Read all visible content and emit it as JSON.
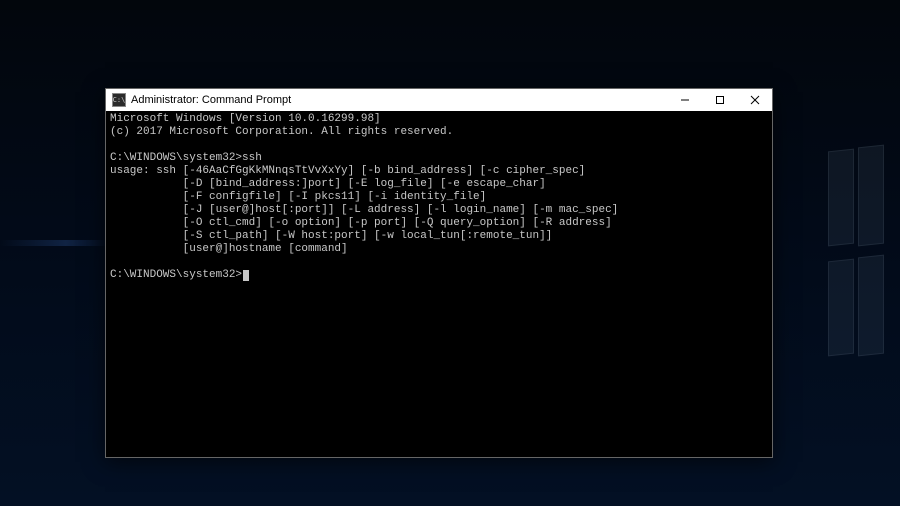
{
  "window": {
    "title": "Administrator: Command Prompt",
    "icon_label": "C:\\"
  },
  "terminal": {
    "banner_line1": "Microsoft Windows [Version 10.0.16299.98]",
    "banner_line2": "(c) 2017 Microsoft Corporation. All rights reserved.",
    "prompt1_path": "C:\\WINDOWS\\system32>",
    "prompt1_cmd": "ssh",
    "usage_lines": [
      "usage: ssh [-46AaCfGgKkMNnqsTtVvXxYy] [-b bind_address] [-c cipher_spec]",
      "           [-D [bind_address:]port] [-E log_file] [-e escape_char]",
      "           [-F configfile] [-I pkcs11] [-i identity_file]",
      "           [-J [user@]host[:port]] [-L address] [-l login_name] [-m mac_spec]",
      "           [-O ctl_cmd] [-o option] [-p port] [-Q query_option] [-R address]",
      "           [-S ctl_path] [-W host:port] [-w local_tun[:remote_tun]]",
      "           [user@]hostname [command]"
    ],
    "prompt2_path": "C:\\WINDOWS\\system32>"
  }
}
